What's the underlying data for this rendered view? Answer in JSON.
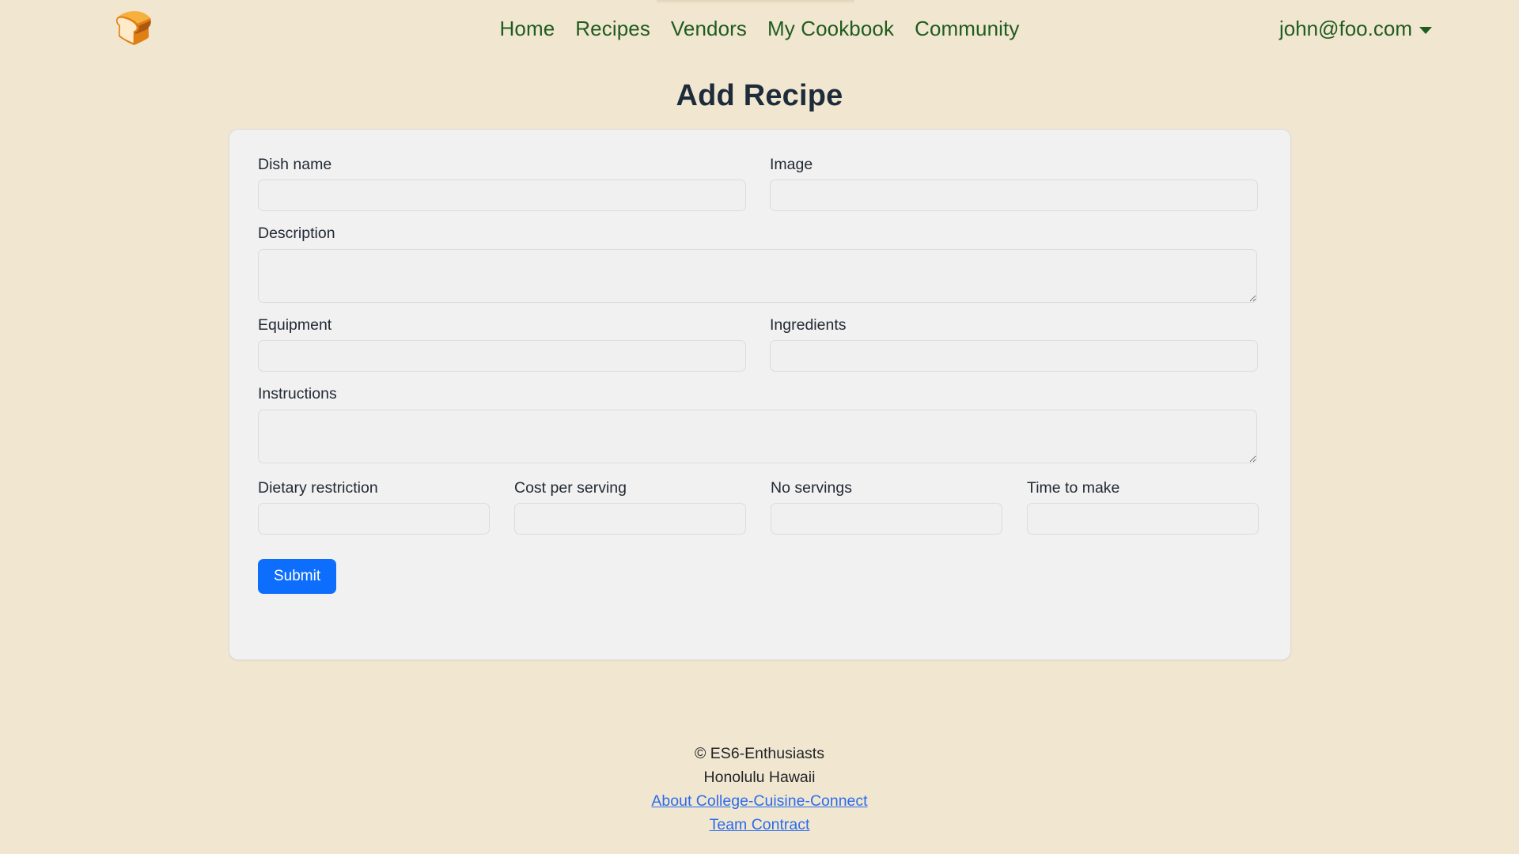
{
  "navbar": {
    "brand_icon": "bread-toast-logo",
    "brand_glyph": "🍞",
    "links": [
      {
        "label": "Home"
      },
      {
        "label": "Recipes"
      },
      {
        "label": "Vendors"
      },
      {
        "label": "My Cookbook"
      },
      {
        "label": "Community"
      }
    ],
    "user": {
      "email": "john@foo.com",
      "caret_icon": "chevron-down-icon"
    },
    "link_color": "#1f5c1f"
  },
  "page": {
    "title": "Add Recipe",
    "background_color": "#f1e6d0",
    "card_background_color": "#f1f1f1"
  },
  "form": {
    "fields": {
      "dish_name": {
        "label": "Dish name",
        "value": "",
        "placeholder": ""
      },
      "image": {
        "label": "Image",
        "value": "",
        "placeholder": ""
      },
      "description": {
        "label": "Description",
        "value": "",
        "placeholder": ""
      },
      "equipment": {
        "label": "Equipment",
        "value": "",
        "placeholder": ""
      },
      "ingredients": {
        "label": "Ingredients",
        "value": "",
        "placeholder": ""
      },
      "instructions": {
        "label": "Instructions",
        "value": "",
        "placeholder": ""
      },
      "dietary": {
        "label": "Dietary restriction",
        "value": "",
        "placeholder": ""
      },
      "cost": {
        "label": "Cost per serving",
        "value": "",
        "placeholder": ""
      },
      "servings": {
        "label": "No servings",
        "value": "",
        "placeholder": ""
      },
      "time": {
        "label": "Time to make",
        "value": "",
        "placeholder": ""
      }
    },
    "submit": {
      "label": "Submit",
      "color": "#0d6efd"
    }
  },
  "footer": {
    "copyright": "© ES6-Enthusiasts",
    "location": "Honolulu Hawaii",
    "links": [
      {
        "label": "About College-Cuisine-Connect"
      },
      {
        "label": "Team Contract"
      }
    ],
    "link_color": "#2a6ced"
  }
}
